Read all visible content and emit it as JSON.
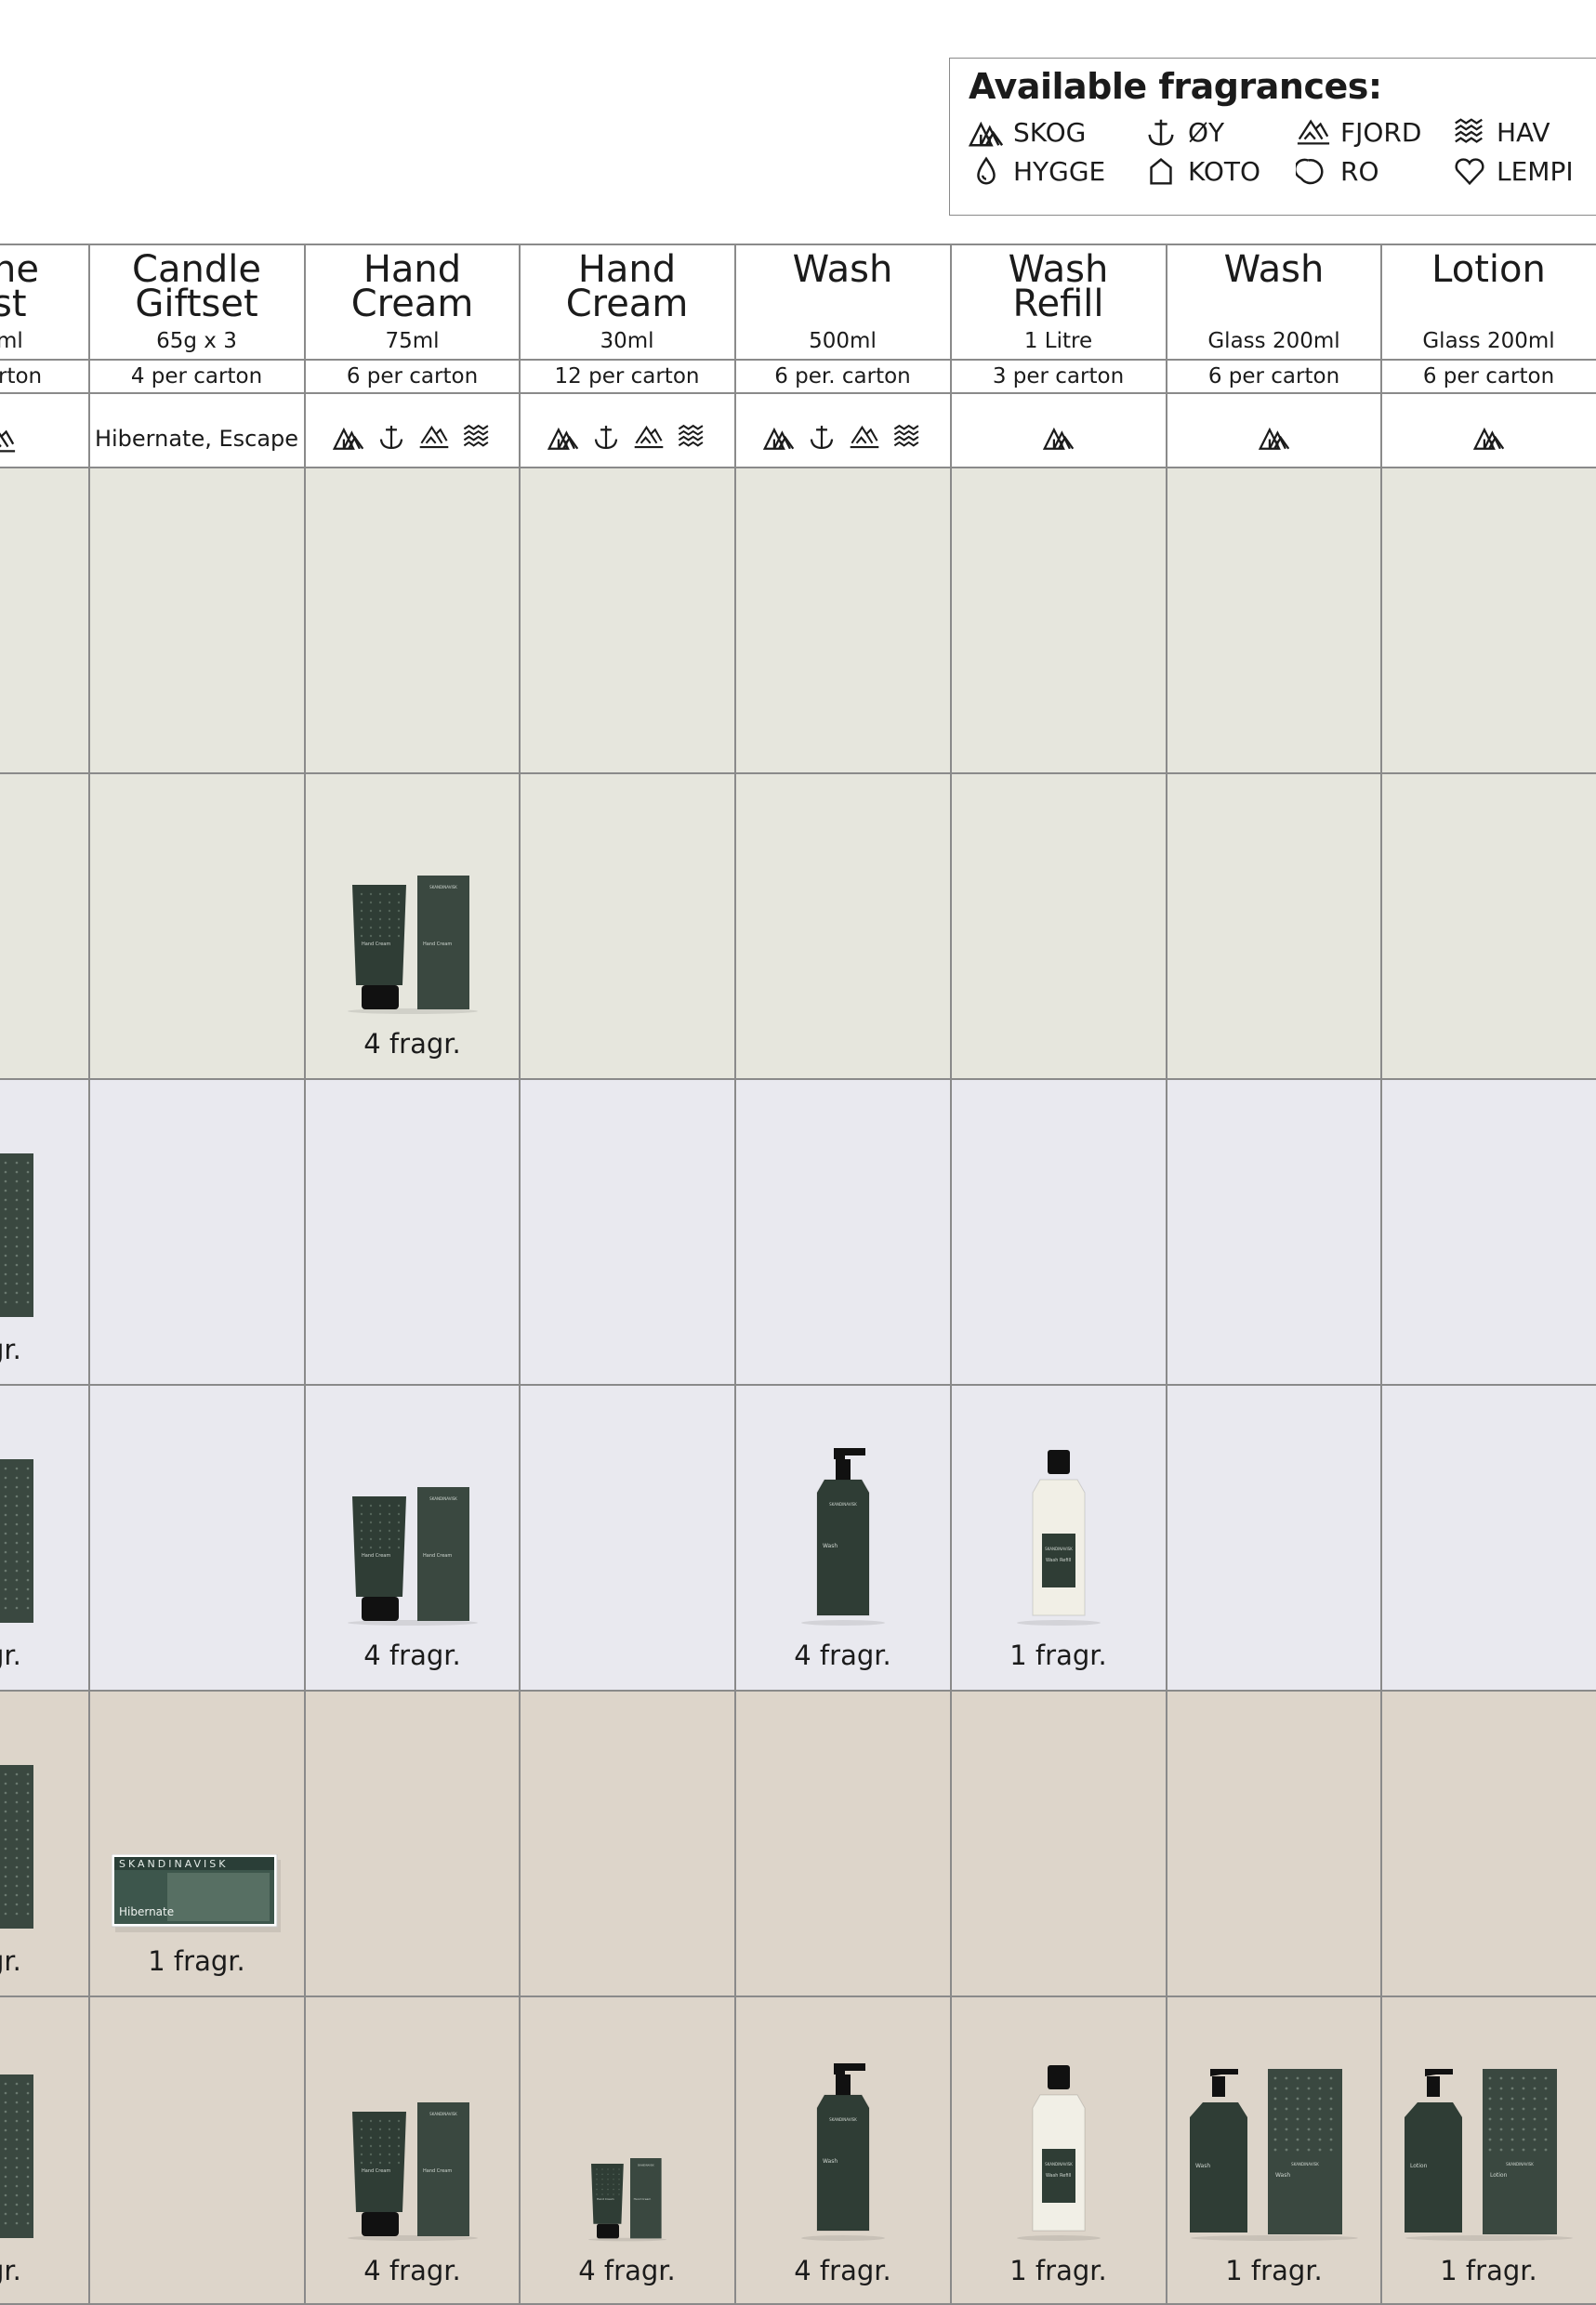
{
  "legend": {
    "title": "Available fragrances:",
    "fragrances": [
      {
        "name": "SKOG",
        "icon": "trees-icon"
      },
      {
        "name": "ØY",
        "icon": "anchor-icon"
      },
      {
        "name": "FJORD",
        "icon": "mountain-icon"
      },
      {
        "name": "HAV",
        "icon": "waves-icon"
      },
      {
        "name": "HYGGE",
        "icon": "drop-icon"
      },
      {
        "name": "KOTO",
        "icon": "house-icon"
      },
      {
        "name": "RO",
        "icon": "moon-icon"
      },
      {
        "name": "LEMPI",
        "icon": "heart-icon"
      }
    ]
  },
  "partial_column": {
    "title_lines": [
      "ne",
      "st"
    ],
    "size": "ml",
    "pack": "rton",
    "cells": [
      "",
      "",
      "gr.",
      "gr.",
      "gr.",
      "gr."
    ]
  },
  "columns": [
    {
      "title": "Candle Giftset",
      "size": "65g x 3",
      "pack": "4 per carton",
      "fragrance_text": "Hibernate, Escape",
      "fragrance_icons": [],
      "cells": [
        "",
        "",
        "",
        "",
        "1 fragr.",
        ""
      ]
    },
    {
      "title": "Hand Cream",
      "size": "75ml",
      "pack": "6 per carton",
      "fragrance_text": "",
      "fragrance_icons": [
        "trees-icon",
        "anchor-icon",
        "mountain-icon",
        "waves-icon"
      ],
      "cells": [
        "",
        "4 fragr.",
        "",
        "4 fragr.",
        "",
        "4 fragr."
      ]
    },
    {
      "title": "Hand Cream",
      "size": "30ml",
      "pack": "12 per carton",
      "fragrance_text": "",
      "fragrance_icons": [
        "trees-icon",
        "anchor-icon",
        "mountain-icon",
        "waves-icon"
      ],
      "cells": [
        "",
        "",
        "",
        "",
        "",
        "4 fragr."
      ]
    },
    {
      "title": "Wash",
      "size": "500ml",
      "pack": "6 per. carton",
      "fragrance_text": "",
      "fragrance_icons": [
        "trees-icon",
        "anchor-icon",
        "mountain-icon",
        "waves-icon"
      ],
      "cells": [
        "",
        "",
        "",
        "4 fragr.",
        "",
        "4 fragr."
      ]
    },
    {
      "title": "Wash Refill",
      "size": "1 Litre",
      "pack": "3 per carton",
      "fragrance_text": "",
      "fragrance_icons": [
        "trees-icon"
      ],
      "cells": [
        "",
        "",
        "",
        "1 fragr.",
        "",
        "1 fragr."
      ]
    },
    {
      "title": "Wash",
      "size": "Glass 200ml",
      "pack": "6 per carton",
      "fragrance_text": "",
      "fragrance_icons": [
        "trees-icon"
      ],
      "cells": [
        "",
        "",
        "",
        "",
        "",
        "1 fragr."
      ]
    },
    {
      "title": "Lotion",
      "size": "Glass 200ml",
      "pack": "6 per carton",
      "fragrance_text": "",
      "fragrance_icons": [
        "trees-icon"
      ],
      "cells": [
        "",
        "",
        "",
        "",
        "",
        "1 fragr."
      ]
    }
  ],
  "product_labels": {
    "brand": "SKANDINAVISK",
    "hand_cream": "Hand Cream",
    "wash": "Wash",
    "wash_refill": "Wash Refill",
    "lotion": "Lotion",
    "hibernate": "Hibernate"
  },
  "colors": {
    "row_green": "#e6e6dd",
    "row_blue": "#e9e9ef",
    "row_sand": "#ddd5ca",
    "product_green": "#2f3d35",
    "line": "#8a8a8a"
  }
}
